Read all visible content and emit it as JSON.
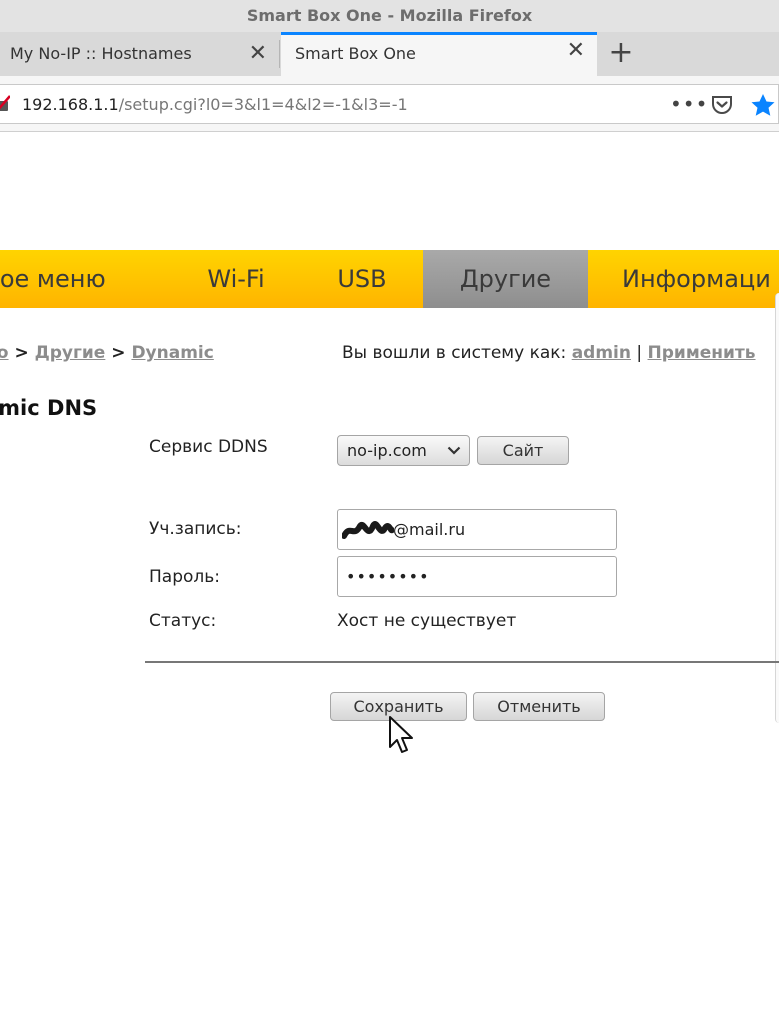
{
  "window": {
    "title": "Smart Box One - Mozilla Firefox"
  },
  "tabs": [
    {
      "label": "My No-IP :: Hostnames",
      "active": false
    },
    {
      "label": "Smart Box One",
      "active": true
    }
  ],
  "toolbar": {
    "url_host": "192.168.1.1",
    "url_path": "/setup.cgi?l0=3&l1=4&l2=-1&l3=-1",
    "page_actions": "•••",
    "accent_color": "#0a84ff"
  },
  "nav": {
    "items": [
      "вное меню",
      "Wi-Fi",
      "USB",
      "Другие",
      "Информаци"
    ],
    "active": "Другие",
    "bar_color": "#ffc400",
    "active_color": "#999999"
  },
  "breadcrumb": {
    "lead": "ю",
    "sep1": " > ",
    "other": "Другие",
    "sep2": " > ",
    "current": "Dynamic"
  },
  "login": {
    "prefix": "Вы вошли в систему как: ",
    "user": "admin",
    "separator": " | ",
    "apply": "Применить"
  },
  "page": {
    "title": "amic DNS"
  },
  "form": {
    "service_label": "Сервис DDNS",
    "service_value": "no-ip.com",
    "site_button": "Сайт",
    "account_label": "Уч.запись:",
    "account_value": "@mail.ru",
    "password_label": "Пароль:",
    "password_value": "••••••••",
    "status_label": "Статус:",
    "status_value": "Хост не существует",
    "save_button": "Сохранить",
    "cancel_button": "Отменить"
  }
}
